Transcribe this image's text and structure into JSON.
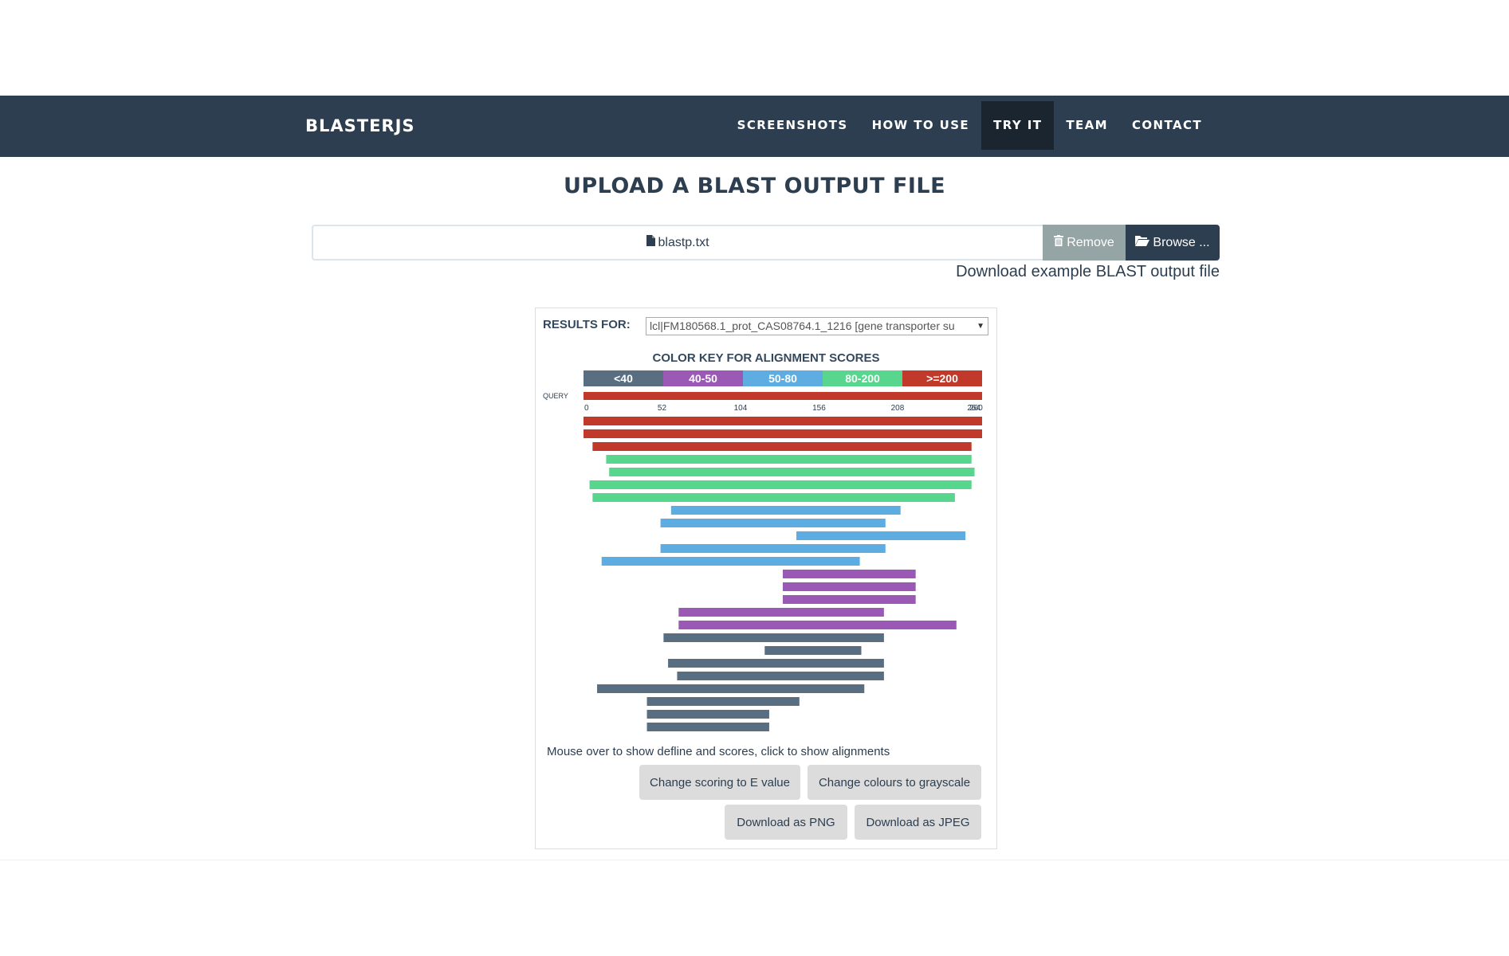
{
  "nav": {
    "brand": "BLASTERJS",
    "items": [
      {
        "label": "SCREENSHOTS",
        "active": false
      },
      {
        "label": "HOW TO USE",
        "active": false
      },
      {
        "label": "TRY IT",
        "active": true
      },
      {
        "label": "TEAM",
        "active": false
      },
      {
        "label": "CONTACT",
        "active": false
      }
    ]
  },
  "page": {
    "title": "UPLOAD A BLAST OUTPUT FILE"
  },
  "upload": {
    "file_name": "blastp.txt",
    "file_icon": "file-icon",
    "remove_label": "Remove",
    "remove_icon": "trash-icon",
    "browse_label": "Browse ...",
    "browse_icon": "folder-open-icon",
    "example_link": "Download example BLAST output file"
  },
  "results": {
    "label": "RESULTS FOR:",
    "selected_query": "lcl|FM180568.1_prot_CAS08764.1_1216 [gene transporter su",
    "hint": "Mouse over to show defline and scores, click to show alignments",
    "buttons": {
      "change_scoring": "Change scoring to E value",
      "change_colours": "Change colours to grayscale",
      "download_png": "Download as PNG",
      "download_jpeg": "Download as JPEG"
    }
  },
  "chart_data": {
    "type": "bar",
    "title": "COLOR KEY FOR ALIGNMENT SCORES",
    "query_label": "QUERY",
    "query_length": 264,
    "ticks": [
      0,
      52,
      104,
      156,
      208,
      260,
      264
    ],
    "color_key": [
      {
        "label": "<40",
        "color": "#5a6e82"
      },
      {
        "label": "40-50",
        "color": "#9b59b6"
      },
      {
        "label": "50-80",
        "color": "#5dade2"
      },
      {
        "label": "80-200",
        "color": "#58d68d"
      },
      {
        "label": ">=200",
        "color": "#c0392b"
      }
    ],
    "alignments": [
      {
        "start": 0,
        "end": 264,
        "score_class": ">=200"
      },
      {
        "start": 0,
        "end": 264,
        "score_class": ">=200"
      },
      {
        "start": 6,
        "end": 257,
        "score_class": ">=200"
      },
      {
        "start": 15,
        "end": 257,
        "score_class": "80-200"
      },
      {
        "start": 17,
        "end": 259,
        "score_class": "80-200"
      },
      {
        "start": 4,
        "end": 257,
        "score_class": "80-200"
      },
      {
        "start": 6,
        "end": 246,
        "score_class": "80-200"
      },
      {
        "start": 58,
        "end": 210,
        "score_class": "50-80"
      },
      {
        "start": 51,
        "end": 200,
        "score_class": "50-80"
      },
      {
        "start": 141,
        "end": 253,
        "score_class": "50-80"
      },
      {
        "start": 51,
        "end": 200,
        "score_class": "50-80"
      },
      {
        "start": 12,
        "end": 183,
        "score_class": "50-80"
      },
      {
        "start": 132,
        "end": 220,
        "score_class": "40-50"
      },
      {
        "start": 132,
        "end": 220,
        "score_class": "40-50"
      },
      {
        "start": 132,
        "end": 220,
        "score_class": "40-50"
      },
      {
        "start": 63,
        "end": 199,
        "score_class": "40-50"
      },
      {
        "start": 63,
        "end": 247,
        "score_class": "40-50"
      },
      {
        "start": 53,
        "end": 199,
        "score_class": "<40"
      },
      {
        "start": 120,
        "end": 184,
        "score_class": "<40"
      },
      {
        "start": 56,
        "end": 199,
        "score_class": "<40"
      },
      {
        "start": 62,
        "end": 199,
        "score_class": "<40"
      },
      {
        "start": 9,
        "end": 186,
        "score_class": "<40"
      },
      {
        "start": 42,
        "end": 143,
        "score_class": "<40"
      },
      {
        "start": 42,
        "end": 123,
        "score_class": "<40"
      },
      {
        "start": 42,
        "end": 123,
        "score_class": "<40"
      }
    ]
  }
}
